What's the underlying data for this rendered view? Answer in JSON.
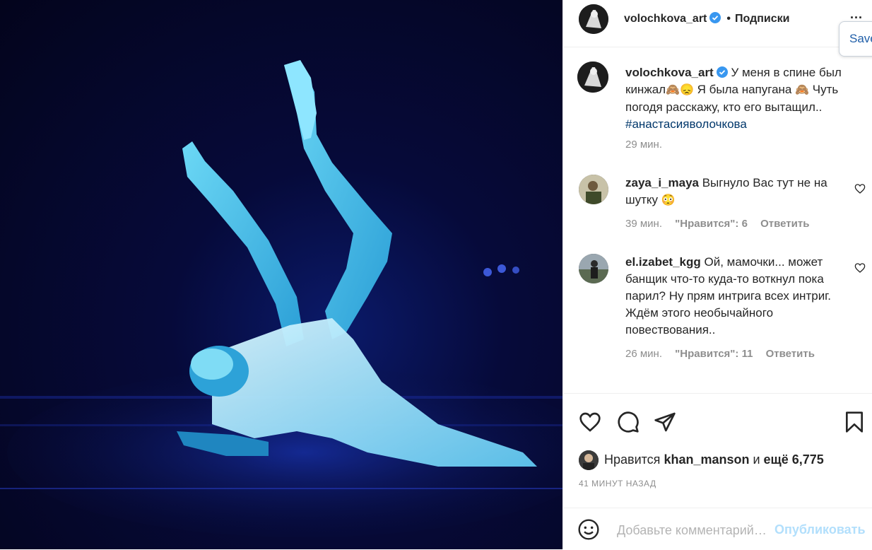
{
  "post": {
    "author": "volochkova_art",
    "follow_label": "Подписки",
    "more_label": "...",
    "save_popup_label": "Save"
  },
  "caption": {
    "author": "volochkova_art",
    "text_1": "У меня в спине был кинжал",
    "emoji_1": "🙈😞",
    "text_2": " Я была напугана ",
    "emoji_2": "🙈",
    "text_3": " Чуть погодя расскажу, кто его вытащил.. ",
    "hashtag": "#анастасияволочкова",
    "time": "29 мин."
  },
  "comments": [
    {
      "author": "zaya_i_maya",
      "text": "Выгнуло Вас тут не на шутку ",
      "emoji": "😳",
      "time": "39 мин.",
      "likes": "\"Нравится\": 6",
      "reply": "Ответить"
    },
    {
      "author": "el.izabet_kgg",
      "text": "Ой, мамочки... может банщик что-то куда-то воткнул пока парил? Ну прям интрига всех интриг. Ждём этого необычайного повествования..",
      "emoji": "",
      "time": "26 мин.",
      "likes": "\"Нравится\": 11",
      "reply": "Ответить"
    }
  ],
  "likes": {
    "prefix": "Нравится ",
    "user": "khan_manson",
    "middle": " и ",
    "count": "ещё 6,775"
  },
  "posted_ago": "41 МИНУТ НАЗАД",
  "add_comment": {
    "placeholder": "Добавьте комментарий…",
    "publish_label": "Опубликовать"
  },
  "icons": {
    "like": "heart-icon",
    "comment": "comment-icon",
    "share": "paper-plane-icon",
    "save": "bookmark-icon",
    "emoji": "smiley-icon",
    "verified": "verified-badge-icon"
  },
  "colors": {
    "text": "#262626",
    "secondary": "#8e8e8e",
    "link": "#00376b",
    "verified": "#3897f0",
    "publish": "#b2dffc"
  }
}
